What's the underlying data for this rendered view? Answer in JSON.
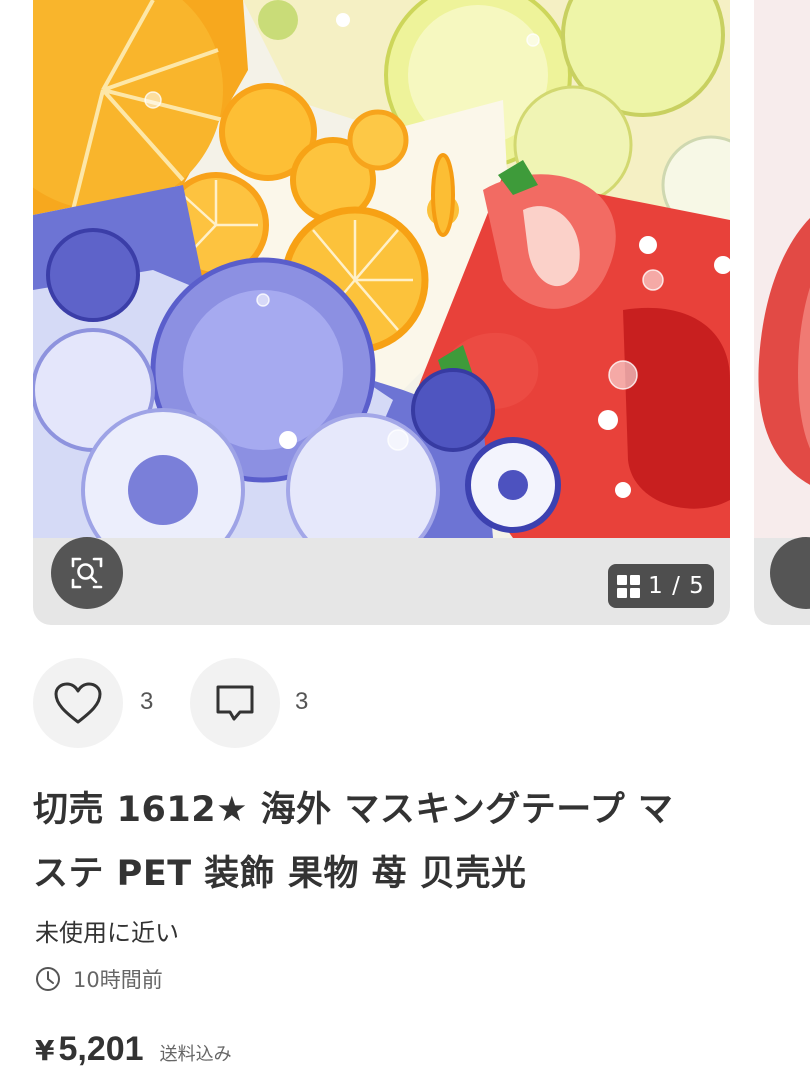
{
  "gallery": {
    "counter_text": "1 / 5"
  },
  "actions": {
    "like_count": "3",
    "comment_count": "3"
  },
  "product": {
    "title_line1": "切売 1612★ 海外 マスキングテープ マ",
    "title_line2": "ステ PET 装飾 果物 苺 贝壳光",
    "condition": "未使用に近い",
    "posted_time": "10時間前",
    "currency": "¥",
    "price": "5,201",
    "shipping": "送料込み"
  },
  "icons": {
    "zoom": "search-zoom-icon",
    "grid": "grid-icon",
    "like": "heart-icon",
    "comment": "comment-icon",
    "clock": "clock-icon"
  },
  "colors": {
    "button_dark": "#555555",
    "card_bg": "#e6e6e6",
    "action_bg": "#f2f2f2",
    "text": "#333333"
  }
}
